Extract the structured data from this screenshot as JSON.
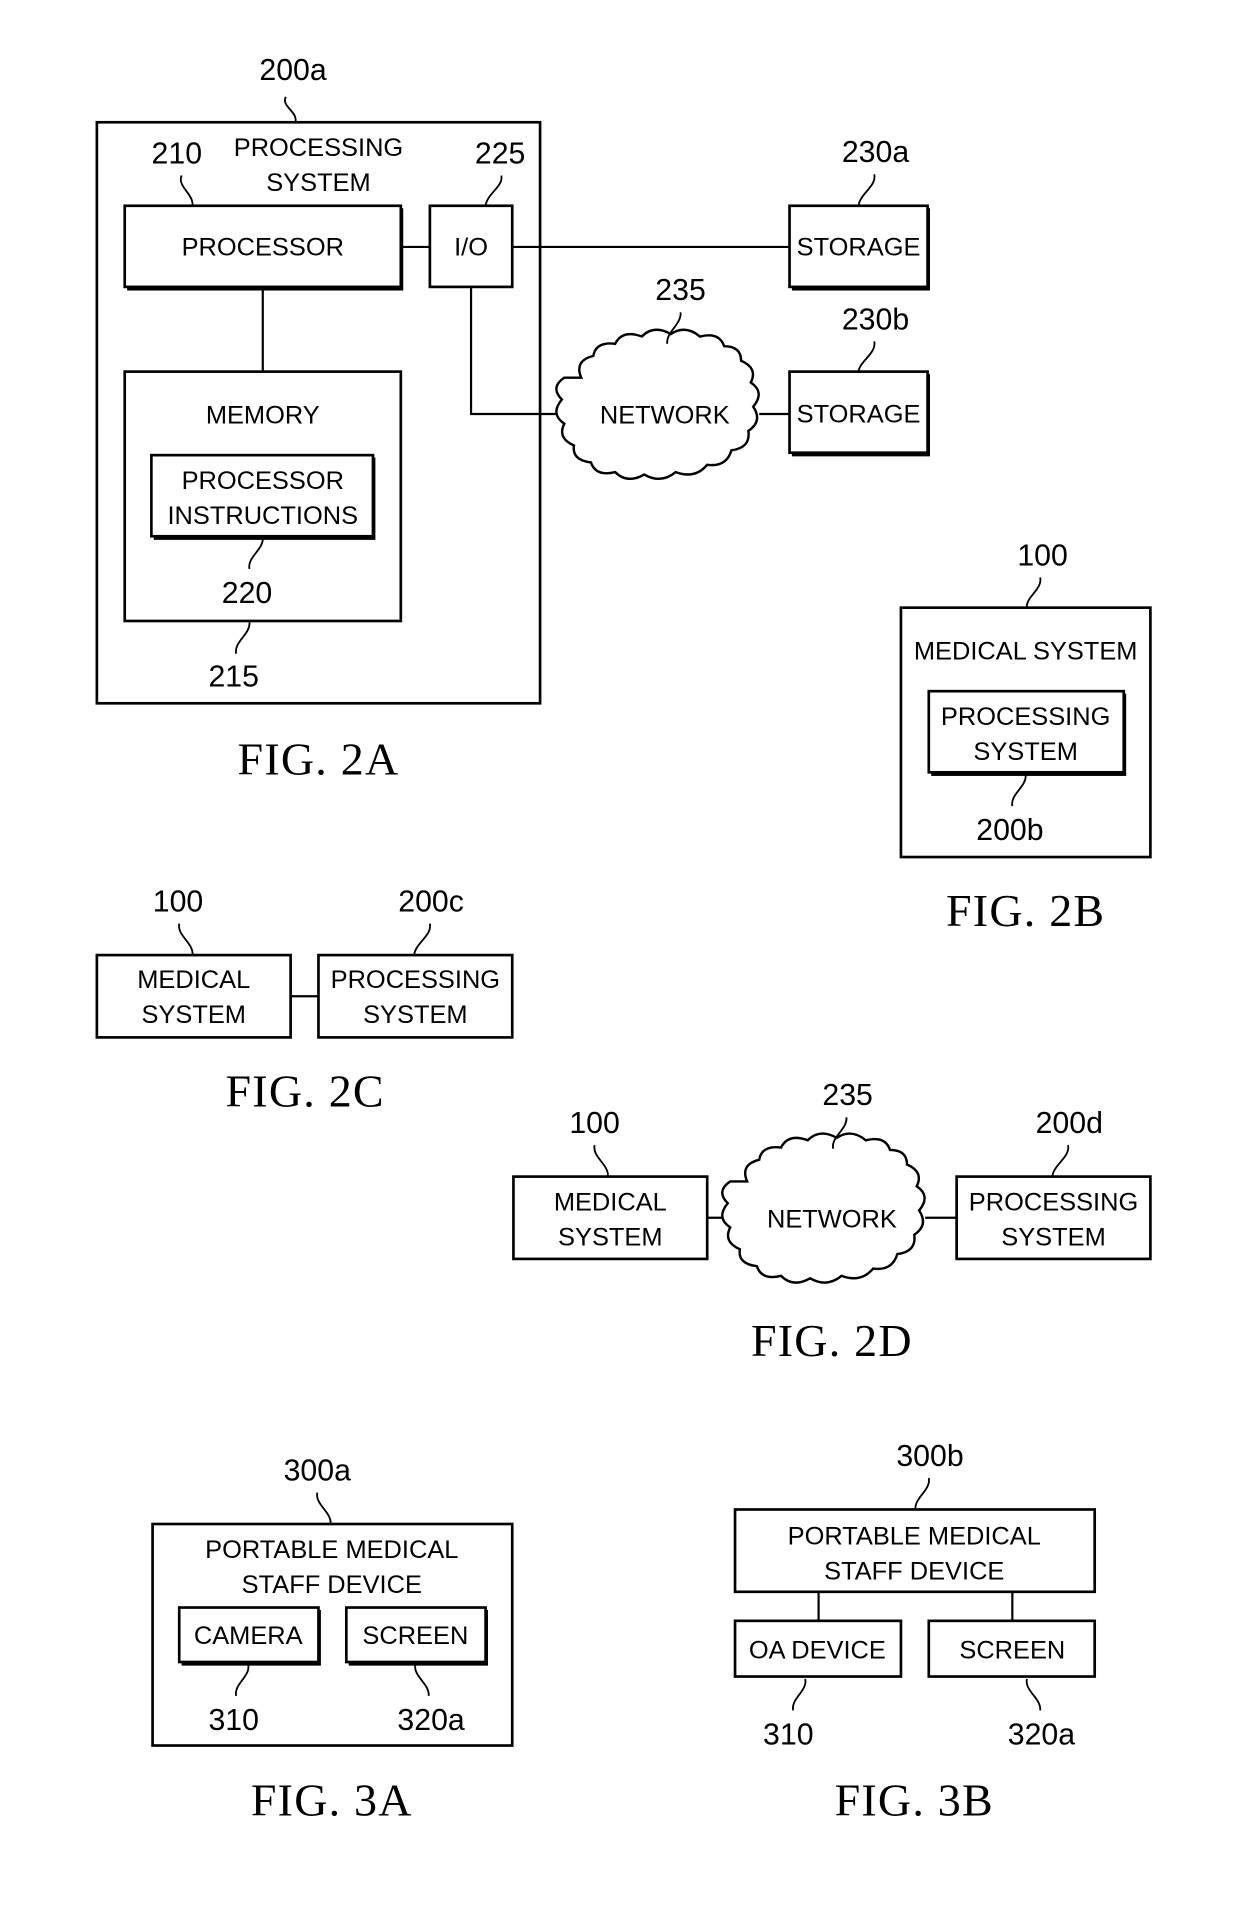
{
  "figures": {
    "fig2a": {
      "caption": "FIG. 2A",
      "processing_system": {
        "ref": "200a",
        "label_line1": "PROCESSING",
        "label_line2": "SYSTEM"
      },
      "processor": {
        "ref": "210",
        "label": "PROCESSOR"
      },
      "io": {
        "ref": "225",
        "label": "I/O"
      },
      "memory": {
        "ref": "215",
        "label": "MEMORY"
      },
      "processor_instructions": {
        "ref": "220",
        "label_line1": "PROCESSOR",
        "label_line2": "INSTRUCTIONS"
      },
      "storage_a": {
        "ref": "230a",
        "label": "STORAGE"
      },
      "storage_b": {
        "ref": "230b",
        "label": "STORAGE"
      },
      "network": {
        "ref": "235",
        "label": "NETWORK"
      }
    },
    "fig2b": {
      "caption": "FIG. 2B",
      "medical_system": {
        "ref": "100",
        "label": "MEDICAL SYSTEM"
      },
      "processing_system": {
        "ref": "200b",
        "label_line1": "PROCESSING",
        "label_line2": "SYSTEM"
      }
    },
    "fig2c": {
      "caption": "FIG. 2C",
      "medical_system": {
        "ref": "100",
        "label_line1": "MEDICAL",
        "label_line2": "SYSTEM"
      },
      "processing_system": {
        "ref": "200c",
        "label_line1": "PROCESSING",
        "label_line2": "SYSTEM"
      }
    },
    "fig2d": {
      "caption": "FIG. 2D",
      "medical_system": {
        "ref": "100",
        "label_line1": "MEDICAL",
        "label_line2": "SYSTEM"
      },
      "network": {
        "ref": "235",
        "label": "NETWORK"
      },
      "processing_system": {
        "ref": "200d",
        "label_line1": "PROCESSING",
        "label_line2": "SYSTEM"
      }
    },
    "fig3a": {
      "caption": "FIG. 3A",
      "device": {
        "ref": "300a",
        "label_line1": "PORTABLE MEDICAL",
        "label_line2": "STAFF DEVICE"
      },
      "camera": {
        "ref": "310",
        "label": "CAMERA"
      },
      "screen": {
        "ref": "320a",
        "label": "SCREEN"
      }
    },
    "fig3b": {
      "caption": "FIG. 3B",
      "device": {
        "ref": "300b",
        "label_line1": "PORTABLE MEDICAL",
        "label_line2": "STAFF DEVICE"
      },
      "oa_device": {
        "ref": "310",
        "label": "OA DEVICE"
      },
      "screen": {
        "ref": "320a",
        "label": "SCREEN"
      }
    }
  }
}
